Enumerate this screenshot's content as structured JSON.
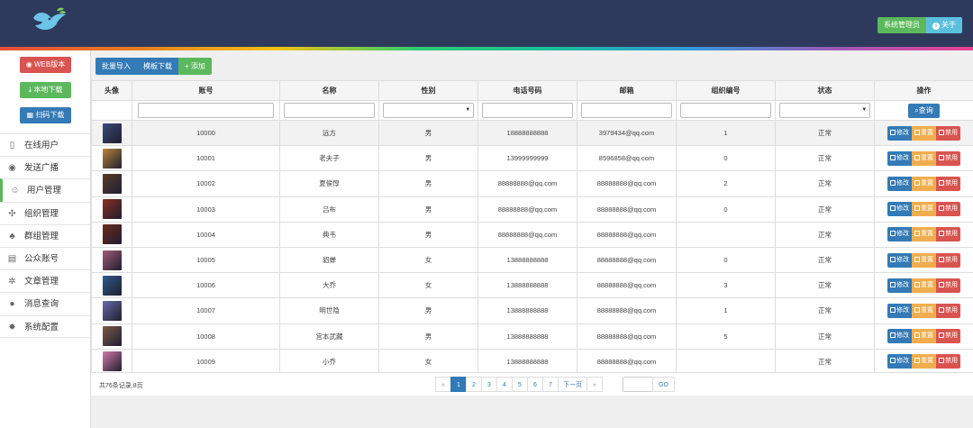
{
  "header": {
    "admin_label": "系统管理员",
    "about_label": "关于",
    "logo_icon": "bird-logo-icon",
    "bg_color": "#2e3a5c"
  },
  "sidebar": {
    "buttons": [
      {
        "label": "WEB版本",
        "icon": "globe-icon",
        "color": "#d9534f"
      },
      {
        "label": "本地下载",
        "icon": "download-icon",
        "color": "#5cb85c"
      },
      {
        "label": "扫码下载",
        "icon": "qrcode-icon",
        "color": "#337ab7"
      }
    ],
    "items": [
      {
        "label": "在线用户",
        "icon": "phone-icon"
      },
      {
        "label": "发送广播",
        "icon": "radio-icon"
      },
      {
        "label": "用户管理",
        "icon": "user-circle-icon",
        "active": true
      },
      {
        "label": "组织管理",
        "icon": "sitemap-icon"
      },
      {
        "label": "群组管理",
        "icon": "group-icon"
      },
      {
        "label": "公众账号",
        "icon": "id-card-icon"
      },
      {
        "label": "文章管理",
        "icon": "gear-icon"
      },
      {
        "label": "消息查询",
        "icon": "chat-icon"
      },
      {
        "label": "系统配置",
        "icon": "cog-icon"
      }
    ]
  },
  "toolbar": {
    "import_label": "批量导入",
    "template_label": "模板下载",
    "add_label": "添加"
  },
  "table": {
    "columns": [
      "头像",
      "账号",
      "名称",
      "性别",
      "电话号码",
      "邮箱",
      "组织编号",
      "状态",
      "操作"
    ],
    "query_label": "查询",
    "actions": {
      "edit": "修改",
      "reset": "重置",
      "ban": "禁用"
    },
    "rows": [
      {
        "account": "10000",
        "name": "远方",
        "gender": "男",
        "phone": "18888888888",
        "email": "3979434@qq.com",
        "org": "1",
        "status": "正常",
        "avatar_color": "#3a4a7a"
      },
      {
        "account": "10001",
        "name": "老夫子",
        "gender": "男",
        "phone": "13999999999",
        "email": "8596858@qq.com",
        "org": "0",
        "status": "正常",
        "avatar_color": "#b8863b"
      },
      {
        "account": "10002",
        "name": "夏侯惇",
        "gender": "男",
        "phone": "88888888@qq.com",
        "email": "88888888@qq.com",
        "org": "2",
        "status": "正常",
        "avatar_color": "#5a3b2a"
      },
      {
        "account": "10003",
        "name": "吕布",
        "gender": "男",
        "phone": "88888888@qq.com",
        "email": "88888888@qq.com",
        "org": "0",
        "status": "正常",
        "avatar_color": "#8b2e22"
      },
      {
        "account": "10004",
        "name": "典韦",
        "gender": "男",
        "phone": "88888888@qq.com",
        "email": "88888888@qq.com",
        "org": "",
        "status": "正常",
        "avatar_color": "#6b2a20"
      },
      {
        "account": "10005",
        "name": "貂蝉",
        "gender": "女",
        "phone": "13888888888",
        "email": "88888888@qq.com",
        "org": "0",
        "status": "正常",
        "avatar_color": "#a05c7a"
      },
      {
        "account": "10006",
        "name": "大乔",
        "gender": "女",
        "phone": "13888888888",
        "email": "88888888@qq.com",
        "org": "3",
        "status": "正常",
        "avatar_color": "#2e5a8a"
      },
      {
        "account": "10007",
        "name": "明世隐",
        "gender": "男",
        "phone": "13888888888",
        "email": "88888888@qq.com",
        "org": "1",
        "status": "正常",
        "avatar_color": "#6a6aa8"
      },
      {
        "account": "10008",
        "name": "宫本武藏",
        "gender": "男",
        "phone": "13888888888",
        "email": "88888888@qq.com",
        "org": "5",
        "status": "正常",
        "avatar_color": "#7a5a4a"
      },
      {
        "account": "10009",
        "name": "小乔",
        "gender": "女",
        "phone": "13888888888",
        "email": "88888888@qq.com",
        "org": "",
        "status": "正常",
        "avatar_color": "#d07aa8"
      }
    ]
  },
  "pager": {
    "total_text": "共76条记录,8页",
    "prev": "«",
    "pages": [
      "1",
      "2",
      "3",
      "4",
      "5",
      "6",
      "7"
    ],
    "active_page": "1",
    "next_label": "下一页",
    "last": "»",
    "go_label": "GO"
  }
}
